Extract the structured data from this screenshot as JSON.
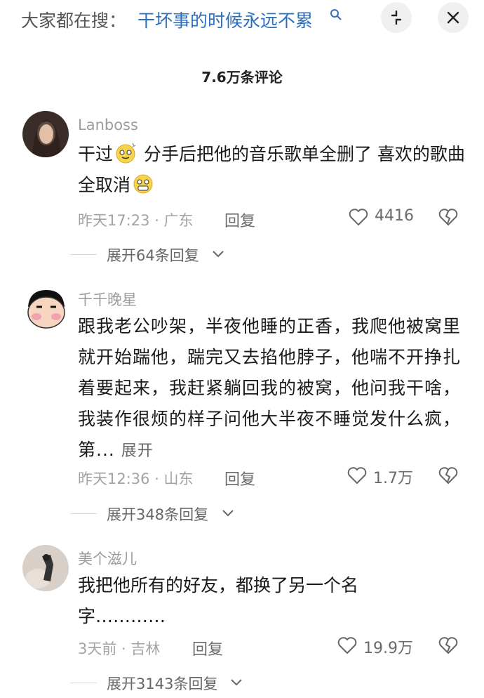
{
  "search": {
    "prefix": "大家都在搜：",
    "query": "干坏事的时候永远不累"
  },
  "header": {
    "comment_count_title": "7.6万条评论"
  },
  "comments": [
    {
      "username": "Lanboss",
      "text_a": "干过",
      "text_b": " 分手后把他的音乐歌单全删了 喜欢的歌曲全取消",
      "time": "昨天17:23 · 广东",
      "reply_label": "回复",
      "likes": "4416",
      "replies": "展开64条回复"
    },
    {
      "username": "千千晚星",
      "text": "跟我老公吵架，半夜他睡的正香，我爬他被窝里就开始踹他，踹完又去掐他脖子，他喘不开挣扎着要起来，我赶紧躺回我的被窝，他问我干啥，我装作很烦的样子问他大半夜不睡觉发什么疯，第...",
      "expand_label": "展开",
      "time": "昨天12:36 · 山东",
      "reply_label": "回复",
      "likes": "1.7万",
      "replies": "展开348条回复"
    },
    {
      "username": "美个滋儿",
      "text": "我把他所有的好友，都换了另一个名字…………",
      "time": "3天前 · 吉林",
      "reply_label": "回复",
      "likes": "19.9万",
      "replies": "展开3143条回复"
    }
  ],
  "colors": {
    "accent_link": "#2d6fbf",
    "meta_gray": "#a3a3a3"
  },
  "icons": [
    "search-icon",
    "collapse-icon",
    "close-icon",
    "heart-icon",
    "broken-heart-icon",
    "chevron-down-icon"
  ]
}
